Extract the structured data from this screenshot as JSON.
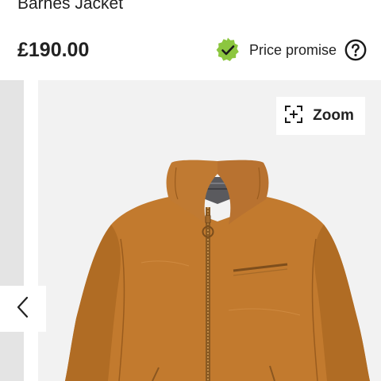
{
  "product": {
    "title": "Barnes Jacket",
    "price": "£190.00"
  },
  "price_promise": {
    "label": "Price promise",
    "badge_icon": "check-badge-icon",
    "info_icon": "question-circle-icon",
    "badge_color": "#8cc63f"
  },
  "gallery": {
    "zoom_label": "Zoom",
    "zoom_icon": "expand-plus-icon",
    "prev_icon": "chevron-left-icon",
    "image_subject": "tan canvas zip jacket",
    "jacket_color": "#c27a2e"
  }
}
